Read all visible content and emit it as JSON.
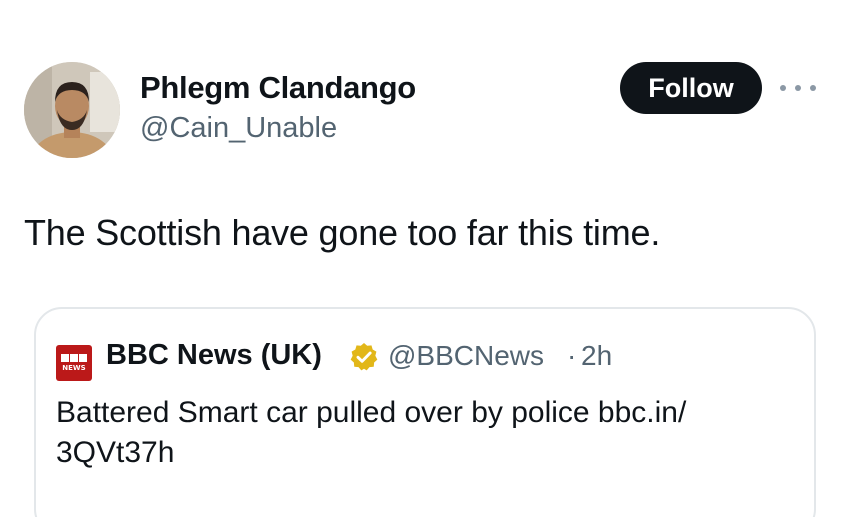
{
  "author": {
    "display_name": "Phlegm Clandango",
    "handle": "@Cain_Unable"
  },
  "actions": {
    "follow_label": "Follow",
    "more_icon": "more-horizontal-icon"
  },
  "tweet": {
    "text": "The Scottish have gone too far this time."
  },
  "quoted_tweet": {
    "source_logo": "bbc-news-logo",
    "display_name": "BBC News (UK)",
    "verified_icon": "gold-verified-badge-icon",
    "handle": "@BBCNews",
    "separator": "·",
    "time": "2h",
    "text_line1": "Battered Smart car pulled over by police bbc.in/",
    "text_line2": "3QVt37h"
  },
  "colors": {
    "text_primary": "#0f1419",
    "text_secondary": "#536471",
    "follow_bg": "#0f1419",
    "bbc_red": "#bb1919",
    "verified_gold": "#e2b719",
    "border": "#e3e7ea"
  }
}
